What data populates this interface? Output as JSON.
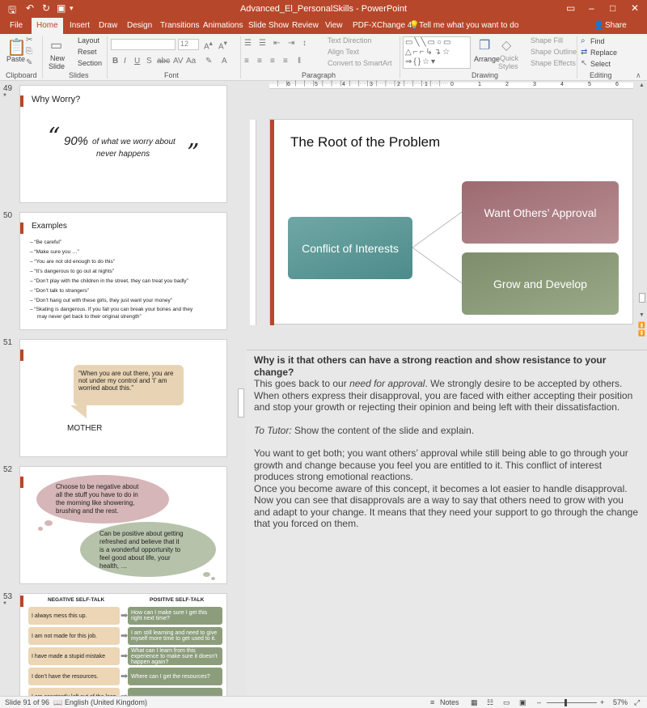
{
  "app": {
    "doc_title": "Advanced_El_PersonalSkills  -  PowerPoint"
  },
  "tabs": [
    "File",
    "Home",
    "Insert",
    "Draw",
    "Design",
    "Transitions",
    "Animations",
    "Slide Show",
    "Review",
    "View",
    "PDF-XChange 4"
  ],
  "tell_me": "Tell me what you want to do",
  "share": "Share",
  "ribbon": {
    "clipboard": {
      "label": "Clipboard",
      "paste": "Paste"
    },
    "slides": {
      "label": "Slides",
      "new_slide_1": "New",
      "new_slide_2": "Slide",
      "layout": "Layout",
      "reset": "Reset",
      "section": "Section"
    },
    "font": {
      "label": "Font",
      "size": "12"
    },
    "paragraph": {
      "label": "Paragraph",
      "text_direction": "Text Direction",
      "align_text": "Align Text",
      "convert": "Convert to SmartArt"
    },
    "drawing": {
      "label": "Drawing",
      "arrange": "Arrange",
      "quick_styles_1": "Quick",
      "quick_styles_2": "Styles",
      "shape_fill": "Shape Fill",
      "shape_outline": "Shape Outline",
      "shape_effects": "Shape Effects"
    },
    "editing": {
      "label": "Editing",
      "find": "Find",
      "replace": "Replace",
      "select": "Select"
    }
  },
  "thumbnails": {
    "s49": {
      "num": "49",
      "star": "*",
      "title": "Why Worry?",
      "quote_num": "90%",
      "quote_text_1": "of what we worry about",
      "quote_text_2": "never happens",
      "open": "“",
      "close": "”"
    },
    "s50": {
      "num": "50",
      "title": "Examples",
      "items": [
        "–  “Be careful”",
        "–  “Make sure you …”",
        "–  “You are not old enough to do this”",
        "–  “It’s dangerous to go out at nights”",
        "–  “Don’t play with the children in the street, they can treat you badly”",
        "–  “Don’t talk to strangers”",
        "–  “Don’t hang out with these girls, they just want your money”",
        "–  “Skating is dangerous. If you fall you can break your bones and they",
        "     may never get back to their original strength”"
      ]
    },
    "s51": {
      "num": "51",
      "bubble": [
        "“When you are out there, you are",
        "not under my control and ‘I’ am",
        "worried about this.”"
      ],
      "speaker": "MOTHER"
    },
    "s52": {
      "num": "52",
      "cloud1": [
        "Choose to be negative about",
        "all the stuff you have to do in",
        "the morning like showering,",
        "brushing and the rest."
      ],
      "cloud2": [
        "Can be positive about getting",
        "refreshed and believe that it",
        "is a wonderful opportunity to",
        "feel good about life, your",
        "health, …"
      ]
    },
    "s53": {
      "num": "53",
      "star": "*",
      "neg_header": "NEGATIVE SELF-TALK",
      "pos_header": "POSITIVE SELF-TALK",
      "neg": [
        "I always mess this up.",
        "I am not made for this job.",
        "I have made a stupid mistake",
        "I don’t have the resources.",
        "I am constantly left out of the loop"
      ],
      "pos": [
        "How can I make sure I get this right next time?",
        "I am still learning and need to give myself more time to get used to it.",
        "What can I learn from this experience to make sure it doesn’t happen again?",
        "Where can I get the resources?",
        ""
      ]
    }
  },
  "slide": {
    "title": "The Root of the Problem",
    "box_left": "Conflict of Interests",
    "box_top": "Want Others’ Approval",
    "box_bottom": "Grow and Develop"
  },
  "ruler": {
    "marks": [
      "6",
      "5",
      "4",
      "3",
      "2",
      "1",
      "0",
      "1",
      "2",
      "3",
      "4",
      "5",
      "6"
    ]
  },
  "notes": {
    "heading": "Why is it that others can have a strong reaction and show resistance to your change?",
    "p1_a": "This goes back to our ",
    "p1_em": "need for approval",
    "p1_b": ". We strongly desire to be accepted by others. When others express their disapproval, you are faced with either accepting their position and stop your growth or rejecting their opinion and being left with their dissatisfaction.",
    "tutor_em": "To Tutor:",
    "tutor_rest": " Show the content of the slide and explain.",
    "p3": "You want to get both; you want others’ approval while still being able to go through your growth and change because you feel you are entitled to it. This conflict of interest produces strong emotional reactions.",
    "p4": "Once you become aware of this concept, it becomes a lot easier to handle disapproval. Now you can see that disapprovals are a way to say that others need to grow with you and adapt to your change. It means that they need your support to go through the change that you forced on them."
  },
  "status": {
    "slide": "Slide 91 of 96",
    "language": "English (United Kingdom)",
    "notes": "Notes",
    "zoom": "57%"
  },
  "colors": {
    "accent": "#b7472a",
    "teal": "#5e9a9a",
    "rose": "#a8767c",
    "sage": "#8a9a78"
  }
}
